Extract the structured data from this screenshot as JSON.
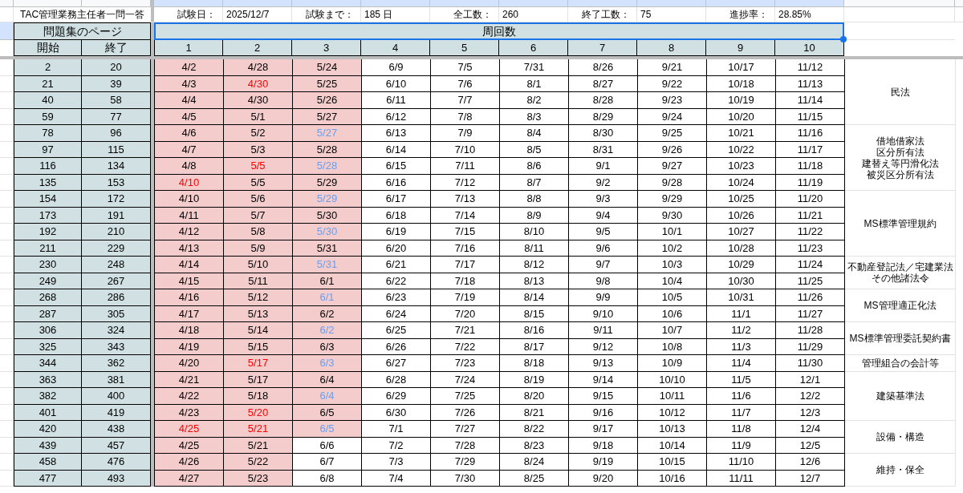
{
  "sheet_title": "TAC管理業務主任者一問一答",
  "stats": [
    {
      "label": "試験日：",
      "value": "2025/12/7"
    },
    {
      "label": "試験まで：",
      "value": "185 日"
    },
    {
      "label": "全工数：",
      "value": "260"
    },
    {
      "label": "終了工数：",
      "value": "75"
    },
    {
      "label": "進捗率：",
      "value": "28.85%"
    }
  ],
  "page_header": "問題集のページ",
  "page_columns": [
    "開始",
    "終了"
  ],
  "rounds_header": {
    "text": "周回数",
    "selected": true
  },
  "round_columns": [
    "1",
    "2",
    "3",
    "4",
    "5",
    "6",
    "7",
    "8",
    "9",
    "10"
  ],
  "groups": [
    {
      "label_lines": [
        "民法"
      ],
      "rows": [
        {
          "start": "2",
          "end": "20",
          "dates": [
            {
              "text": "4/2",
              "done": true
            },
            {
              "text": "4/28",
              "done": true
            },
            {
              "text": "5/24",
              "done": true
            },
            {
              "text": "6/9",
              "done": false
            },
            {
              "text": "7/5",
              "done": false
            },
            {
              "text": "7/31",
              "done": false
            },
            {
              "text": "8/26",
              "done": false
            },
            {
              "text": "9/21",
              "done": false
            },
            {
              "text": "10/17",
              "done": false
            },
            {
              "text": "11/12",
              "done": false
            }
          ]
        },
        {
          "start": "21",
          "end": "39",
          "dates": [
            {
              "text": "4/3",
              "done": true
            },
            {
              "text": "4/30",
              "done": true,
              "color": "#ff0000"
            },
            {
              "text": "5/25",
              "done": true
            },
            {
              "text": "6/10",
              "done": false
            },
            {
              "text": "7/6",
              "done": false
            },
            {
              "text": "8/1",
              "done": false
            },
            {
              "text": "8/27",
              "done": false
            },
            {
              "text": "9/22",
              "done": false
            },
            {
              "text": "10/18",
              "done": false
            },
            {
              "text": "11/13",
              "done": false
            }
          ]
        },
        {
          "start": "40",
          "end": "58",
          "dates": [
            {
              "text": "4/4",
              "done": true
            },
            {
              "text": "4/30",
              "done": true
            },
            {
              "text": "5/26",
              "done": true
            },
            {
              "text": "6/11",
              "done": false
            },
            {
              "text": "7/7",
              "done": false
            },
            {
              "text": "8/2",
              "done": false
            },
            {
              "text": "8/28",
              "done": false
            },
            {
              "text": "9/23",
              "done": false
            },
            {
              "text": "10/19",
              "done": false
            },
            {
              "text": "11/14",
              "done": false
            }
          ]
        },
        {
          "start": "59",
          "end": "77",
          "dates": [
            {
              "text": "4/5",
              "done": true
            },
            {
              "text": "5/1",
              "done": true
            },
            {
              "text": "5/27",
              "done": true
            },
            {
              "text": "6/12",
              "done": false
            },
            {
              "text": "7/8",
              "done": false
            },
            {
              "text": "8/3",
              "done": false
            },
            {
              "text": "8/29",
              "done": false
            },
            {
              "text": "9/24",
              "done": false
            },
            {
              "text": "10/20",
              "done": false
            },
            {
              "text": "11/15",
              "done": false
            }
          ]
        }
      ]
    },
    {
      "label_lines": [
        "借地借家法",
        "区分所有法",
        "建替え等円滑化法",
        "被災区分所有法"
      ],
      "rows": [
        {
          "start": "78",
          "end": "96",
          "dates": [
            {
              "text": "4/6",
              "done": true
            },
            {
              "text": "5/2",
              "done": true
            },
            {
              "text": "5/27",
              "done": true,
              "color": "#6d9eeb"
            },
            {
              "text": "6/13",
              "done": false
            },
            {
              "text": "7/9",
              "done": false
            },
            {
              "text": "8/4",
              "done": false
            },
            {
              "text": "8/30",
              "done": false
            },
            {
              "text": "9/25",
              "done": false
            },
            {
              "text": "10/21",
              "done": false
            },
            {
              "text": "11/16",
              "done": false
            }
          ]
        },
        {
          "start": "97",
          "end": "115",
          "dates": [
            {
              "text": "4/7",
              "done": true
            },
            {
              "text": "5/3",
              "done": true
            },
            {
              "text": "5/28",
              "done": true
            },
            {
              "text": "6/14",
              "done": false
            },
            {
              "text": "7/10",
              "done": false
            },
            {
              "text": "8/5",
              "done": false
            },
            {
              "text": "8/31",
              "done": false
            },
            {
              "text": "9/26",
              "done": false
            },
            {
              "text": "10/22",
              "done": false
            },
            {
              "text": "11/17",
              "done": false
            }
          ]
        },
        {
          "start": "116",
          "end": "134",
          "dates": [
            {
              "text": "4/8",
              "done": true
            },
            {
              "text": "5/5",
              "done": true,
              "color": "#ff0000"
            },
            {
              "text": "5/28",
              "done": true,
              "color": "#6d9eeb"
            },
            {
              "text": "6/15",
              "done": false
            },
            {
              "text": "7/11",
              "done": false
            },
            {
              "text": "8/6",
              "done": false
            },
            {
              "text": "9/1",
              "done": false
            },
            {
              "text": "9/27",
              "done": false
            },
            {
              "text": "10/23",
              "done": false
            },
            {
              "text": "11/18",
              "done": false
            }
          ]
        },
        {
          "start": "135",
          "end": "153",
          "dates": [
            {
              "text": "4/10",
              "done": true,
              "color": "#ff0000"
            },
            {
              "text": "5/5",
              "done": true
            },
            {
              "text": "5/29",
              "done": true
            },
            {
              "text": "6/16",
              "done": false
            },
            {
              "text": "7/12",
              "done": false
            },
            {
              "text": "8/7",
              "done": false
            },
            {
              "text": "9/2",
              "done": false
            },
            {
              "text": "9/28",
              "done": false
            },
            {
              "text": "10/24",
              "done": false
            },
            {
              "text": "11/19",
              "done": false
            }
          ]
        }
      ]
    },
    {
      "label_lines": [
        "MS標準管理規約"
      ],
      "rows": [
        {
          "start": "154",
          "end": "172",
          "dates": [
            {
              "text": "4/10",
              "done": true
            },
            {
              "text": "5/6",
              "done": true
            },
            {
              "text": "5/29",
              "done": true,
              "color": "#6d9eeb"
            },
            {
              "text": "6/17",
              "done": false
            },
            {
              "text": "7/13",
              "done": false
            },
            {
              "text": "8/8",
              "done": false
            },
            {
              "text": "9/3",
              "done": false
            },
            {
              "text": "9/29",
              "done": false
            },
            {
              "text": "10/25",
              "done": false
            },
            {
              "text": "11/20",
              "done": false
            }
          ]
        },
        {
          "start": "173",
          "end": "191",
          "dates": [
            {
              "text": "4/11",
              "done": true
            },
            {
              "text": "5/7",
              "done": true
            },
            {
              "text": "5/30",
              "done": true
            },
            {
              "text": "6/18",
              "done": false
            },
            {
              "text": "7/14",
              "done": false
            },
            {
              "text": "8/9",
              "done": false
            },
            {
              "text": "9/4",
              "done": false
            },
            {
              "text": "9/30",
              "done": false
            },
            {
              "text": "10/26",
              "done": false
            },
            {
              "text": "11/21",
              "done": false
            }
          ]
        },
        {
          "start": "192",
          "end": "210",
          "dates": [
            {
              "text": "4/12",
              "done": true
            },
            {
              "text": "5/8",
              "done": true
            },
            {
              "text": "5/30",
              "done": true,
              "color": "#6d9eeb"
            },
            {
              "text": "6/19",
              "done": false
            },
            {
              "text": "7/15",
              "done": false
            },
            {
              "text": "8/10",
              "done": false
            },
            {
              "text": "9/5",
              "done": false
            },
            {
              "text": "10/1",
              "done": false
            },
            {
              "text": "10/27",
              "done": false
            },
            {
              "text": "11/22",
              "done": false
            }
          ]
        },
        {
          "start": "211",
          "end": "229",
          "dates": [
            {
              "text": "4/13",
              "done": true
            },
            {
              "text": "5/9",
              "done": true
            },
            {
              "text": "5/31",
              "done": true
            },
            {
              "text": "6/20",
              "done": false
            },
            {
              "text": "7/16",
              "done": false
            },
            {
              "text": "8/11",
              "done": false
            },
            {
              "text": "9/6",
              "done": false
            },
            {
              "text": "10/2",
              "done": false
            },
            {
              "text": "10/28",
              "done": false
            },
            {
              "text": "11/23",
              "done": false
            }
          ]
        }
      ]
    },
    {
      "label_lines": [
        "不動産登記法／宅建業法",
        "その他諸法令"
      ],
      "rows": [
        {
          "start": "230",
          "end": "248",
          "dates": [
            {
              "text": "4/14",
              "done": true
            },
            {
              "text": "5/10",
              "done": true
            },
            {
              "text": "5/31",
              "done": true,
              "color": "#6d9eeb"
            },
            {
              "text": "6/21",
              "done": false
            },
            {
              "text": "7/17",
              "done": false
            },
            {
              "text": "8/12",
              "done": false
            },
            {
              "text": "9/7",
              "done": false
            },
            {
              "text": "10/3",
              "done": false
            },
            {
              "text": "10/29",
              "done": false
            },
            {
              "text": "11/24",
              "done": false
            }
          ]
        },
        {
          "start": "249",
          "end": "267",
          "dates": [
            {
              "text": "4/15",
              "done": true
            },
            {
              "text": "5/11",
              "done": true
            },
            {
              "text": "6/1",
              "done": true
            },
            {
              "text": "6/22",
              "done": false
            },
            {
              "text": "7/18",
              "done": false
            },
            {
              "text": "8/13",
              "done": false
            },
            {
              "text": "9/8",
              "done": false
            },
            {
              "text": "10/4",
              "done": false
            },
            {
              "text": "10/30",
              "done": false
            },
            {
              "text": "11/25",
              "done": false
            }
          ]
        }
      ]
    },
    {
      "label_lines": [
        "MS管理適正化法"
      ],
      "rows": [
        {
          "start": "268",
          "end": "286",
          "dates": [
            {
              "text": "4/16",
              "done": true
            },
            {
              "text": "5/12",
              "done": true
            },
            {
              "text": "6/1",
              "done": true,
              "color": "#6d9eeb"
            },
            {
              "text": "6/23",
              "done": false
            },
            {
              "text": "7/19",
              "done": false
            },
            {
              "text": "8/14",
              "done": false
            },
            {
              "text": "9/9",
              "done": false
            },
            {
              "text": "10/5",
              "done": false
            },
            {
              "text": "10/31",
              "done": false
            },
            {
              "text": "11/26",
              "done": false
            }
          ]
        },
        {
          "start": "287",
          "end": "305",
          "dates": [
            {
              "text": "4/17",
              "done": true
            },
            {
              "text": "5/13",
              "done": true
            },
            {
              "text": "6/2",
              "done": true
            },
            {
              "text": "6/24",
              "done": false
            },
            {
              "text": "7/20",
              "done": false
            },
            {
              "text": "8/15",
              "done": false
            },
            {
              "text": "9/10",
              "done": false
            },
            {
              "text": "10/6",
              "done": false
            },
            {
              "text": "11/1",
              "done": false
            },
            {
              "text": "11/27",
              "done": false
            }
          ]
        }
      ]
    },
    {
      "label_lines": [
        "MS標準管理委託契約書"
      ],
      "rows": [
        {
          "start": "306",
          "end": "324",
          "dates": [
            {
              "text": "4/18",
              "done": true
            },
            {
              "text": "5/14",
              "done": true
            },
            {
              "text": "6/2",
              "done": true,
              "color": "#6d9eeb"
            },
            {
              "text": "6/25",
              "done": false
            },
            {
              "text": "7/21",
              "done": false
            },
            {
              "text": "8/16",
              "done": false
            },
            {
              "text": "9/11",
              "done": false
            },
            {
              "text": "10/7",
              "done": false
            },
            {
              "text": "11/2",
              "done": false
            },
            {
              "text": "11/28",
              "done": false
            }
          ]
        },
        {
          "start": "325",
          "end": "343",
          "dates": [
            {
              "text": "4/19",
              "done": true
            },
            {
              "text": "5/15",
              "done": true
            },
            {
              "text": "6/3",
              "done": true
            },
            {
              "text": "6/26",
              "done": false
            },
            {
              "text": "7/22",
              "done": false
            },
            {
              "text": "8/17",
              "done": false
            },
            {
              "text": "9/12",
              "done": false
            },
            {
              "text": "10/8",
              "done": false
            },
            {
              "text": "11/3",
              "done": false
            },
            {
              "text": "11/29",
              "done": false
            }
          ]
        }
      ]
    },
    {
      "label_lines": [
        "管理組合の会計等"
      ],
      "rows": [
        {
          "start": "344",
          "end": "362",
          "dates": [
            {
              "text": "4/20",
              "done": true
            },
            {
              "text": "5/17",
              "done": true,
              "color": "#ff0000"
            },
            {
              "text": "6/3",
              "done": true,
              "color": "#6d9eeb"
            },
            {
              "text": "6/27",
              "done": false
            },
            {
              "text": "7/23",
              "done": false
            },
            {
              "text": "8/18",
              "done": false
            },
            {
              "text": "9/13",
              "done": false
            },
            {
              "text": "10/9",
              "done": false
            },
            {
              "text": "11/4",
              "done": false
            },
            {
              "text": "11/30",
              "done": false
            }
          ]
        }
      ]
    },
    {
      "label_lines": [
        "建築基準法"
      ],
      "rows": [
        {
          "start": "363",
          "end": "381",
          "dates": [
            {
              "text": "4/21",
              "done": true
            },
            {
              "text": "5/17",
              "done": true
            },
            {
              "text": "6/4",
              "done": true
            },
            {
              "text": "6/28",
              "done": false
            },
            {
              "text": "7/24",
              "done": false
            },
            {
              "text": "8/19",
              "done": false
            },
            {
              "text": "9/14",
              "done": false
            },
            {
              "text": "10/10",
              "done": false
            },
            {
              "text": "11/5",
              "done": false
            },
            {
              "text": "12/1",
              "done": false
            }
          ]
        },
        {
          "start": "382",
          "end": "400",
          "dates": [
            {
              "text": "4/22",
              "done": true
            },
            {
              "text": "5/18",
              "done": true
            },
            {
              "text": "6/4",
              "done": true,
              "color": "#6d9eeb"
            },
            {
              "text": "6/29",
              "done": false
            },
            {
              "text": "7/25",
              "done": false
            },
            {
              "text": "8/20",
              "done": false
            },
            {
              "text": "9/15",
              "done": false
            },
            {
              "text": "10/11",
              "done": false
            },
            {
              "text": "11/6",
              "done": false
            },
            {
              "text": "12/2",
              "done": false
            }
          ]
        },
        {
          "start": "401",
          "end": "419",
          "dates": [
            {
              "text": "4/23",
              "done": true
            },
            {
              "text": "5/20",
              "done": true,
              "color": "#ff0000"
            },
            {
              "text": "6/5",
              "done": true
            },
            {
              "text": "6/30",
              "done": false
            },
            {
              "text": "7/26",
              "done": false
            },
            {
              "text": "8/21",
              "done": false
            },
            {
              "text": "9/16",
              "done": false
            },
            {
              "text": "10/12",
              "done": false
            },
            {
              "text": "11/7",
              "done": false
            },
            {
              "text": "12/3",
              "done": false
            }
          ]
        }
      ]
    },
    {
      "label_lines": [
        "設備・構造"
      ],
      "rows": [
        {
          "start": "420",
          "end": "438",
          "dates": [
            {
              "text": "4/25",
              "done": true,
              "color": "#ff0000"
            },
            {
              "text": "5/21",
              "done": true,
              "color": "#ff0000"
            },
            {
              "text": "6/5",
              "done": true,
              "color": "#6d9eeb"
            },
            {
              "text": "7/1",
              "done": false
            },
            {
              "text": "7/27",
              "done": false
            },
            {
              "text": "8/22",
              "done": false
            },
            {
              "text": "9/17",
              "done": false
            },
            {
              "text": "10/13",
              "done": false
            },
            {
              "text": "11/8",
              "done": false
            },
            {
              "text": "12/4",
              "done": false
            }
          ]
        },
        {
          "start": "439",
          "end": "457",
          "dates": [
            {
              "text": "4/25",
              "done": true
            },
            {
              "text": "5/21",
              "done": true
            },
            {
              "text": "6/6",
              "done": false
            },
            {
              "text": "7/2",
              "done": false
            },
            {
              "text": "7/28",
              "done": false
            },
            {
              "text": "8/23",
              "done": false
            },
            {
              "text": "9/18",
              "done": false
            },
            {
              "text": "10/14",
              "done": false
            },
            {
              "text": "11/9",
              "done": false
            },
            {
              "text": "12/5",
              "done": false
            }
          ]
        }
      ]
    },
    {
      "label_lines": [
        "維持・保全"
      ],
      "rows": [
        {
          "start": "458",
          "end": "476",
          "dates": [
            {
              "text": "4/26",
              "done": true
            },
            {
              "text": "5/22",
              "done": true
            },
            {
              "text": "6/7",
              "done": false
            },
            {
              "text": "7/3",
              "done": false
            },
            {
              "text": "7/29",
              "done": false
            },
            {
              "text": "8/24",
              "done": false
            },
            {
              "text": "9/19",
              "done": false
            },
            {
              "text": "10/15",
              "done": false
            },
            {
              "text": "11/10",
              "done": false
            },
            {
              "text": "12/6",
              "done": false
            }
          ]
        },
        {
          "start": "477",
          "end": "493",
          "dates": [
            {
              "text": "4/27",
              "done": true
            },
            {
              "text": "5/23",
              "done": true
            },
            {
              "text": "6/8",
              "done": false
            },
            {
              "text": "7/4",
              "done": false
            },
            {
              "text": "7/30",
              "done": false
            },
            {
              "text": "8/25",
              "done": false
            },
            {
              "text": "9/20",
              "done": false
            },
            {
              "text": "10/16",
              "done": false
            },
            {
              "text": "11/11",
              "done": false
            },
            {
              "text": "12/7",
              "done": false
            }
          ]
        }
      ]
    }
  ]
}
